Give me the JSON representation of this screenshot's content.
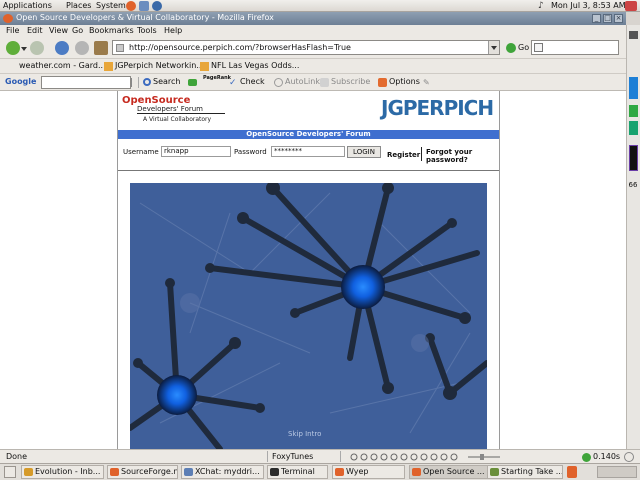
{
  "top_panel": {
    "menus": [
      "Applications",
      "Places",
      "System"
    ],
    "clock": "Mon Jul  3,  8:53 AM"
  },
  "window": {
    "title": "Open Source Developers & Virtual Collaboratory - Mozilla Firefox"
  },
  "menubar": [
    "File",
    "Edit",
    "View",
    "Go",
    "Bookmarks",
    "Tools",
    "Help"
  ],
  "navbar": {
    "url": "http://opensource.perpich.com/?browserHasFlash=True",
    "go_label": "Go"
  },
  "bookmarks": [
    "weather.com - Gard...",
    "JGPerpich Networkin...",
    "NFL Las Vegas Odds..."
  ],
  "google_bar": {
    "brand": "Google",
    "search_label": "Search",
    "pagerank_label": "PageRank",
    "check_label": "Check",
    "autolink_label": "AutoLink",
    "subscribe_label": "Subscribe",
    "options_label": "Options"
  },
  "page": {
    "logo_line1": "OpenSource",
    "logo_line2": "Developers' Forum",
    "logo_line3": "A Virtual Collaboratory",
    "brand_logo": "JGPERPICH",
    "banner": "OpenSource Developers' Forum",
    "username_label": "Username",
    "username_value": "rknapp",
    "password_label": "Password",
    "password_value": "********",
    "login_button": "LOGIN",
    "register_link": "Register",
    "forgot_line1": "Forgot your",
    "forgot_line2": "password?",
    "skip_intro": "Skip Intro"
  },
  "status": {
    "text": "Done",
    "foxytunes": "FoxyTunes",
    "timer": "0.140s"
  },
  "scrollbar_number": "66",
  "taskbar": [
    {
      "label": "Evolution - Inb...",
      "color": "#d69b2a"
    },
    {
      "label": "SourceForge.n...",
      "color": "#e0622b"
    },
    {
      "label": "XChat: myddri...",
      "color": "#5d7fb5"
    },
    {
      "label": "Terminal",
      "color": "#2b2b2b"
    },
    {
      "label": "Wyep",
      "color": "#e0622b"
    },
    {
      "label": "Open Source ...",
      "color": "#e0622b"
    },
    {
      "label": "Starting Take ...",
      "color": "#6a8f3a"
    }
  ]
}
